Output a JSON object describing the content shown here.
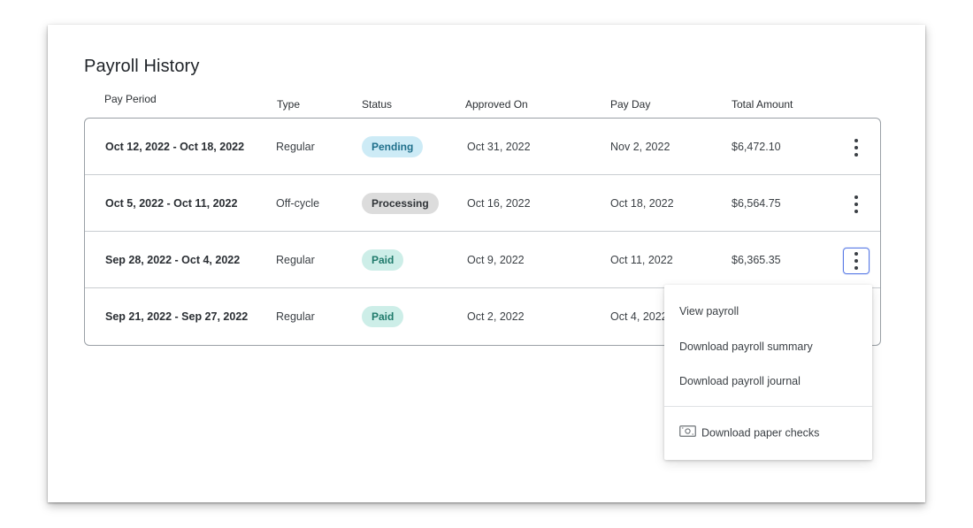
{
  "page": {
    "title": "Payroll History"
  },
  "columns": {
    "pay_period": "Pay Period",
    "type": "Type",
    "status": "Status",
    "approved_on": "Approved On",
    "pay_day": "Pay Day",
    "total_amount": "Total Amount"
  },
  "rows": [
    {
      "pay_period": "Oct 12, 2022 - Oct 18, 2022",
      "type": "Regular",
      "status": "Pending",
      "approved_on": "Oct 31, 2022",
      "pay_day": "Nov 2, 2022",
      "total_amount": "$6,472.10"
    },
    {
      "pay_period": "Oct 5, 2022 - Oct 11, 2022",
      "type": "Off-cycle",
      "status": "Processing",
      "approved_on": "Oct 16, 2022",
      "pay_day": "Oct 18, 2022",
      "total_amount": "$6,564.75"
    },
    {
      "pay_period": "Sep 28, 2022 - Oct 4, 2022",
      "type": "Regular",
      "status": "Paid",
      "approved_on": "Oct 9, 2022",
      "pay_day": "Oct 11, 2022",
      "total_amount": "$6,365.35"
    },
    {
      "pay_period": "Sep 21, 2022 - Sep 27, 2022",
      "type": "Regular",
      "status": "Paid",
      "approved_on": "Oct 2, 2022",
      "pay_day": "Oct 4, 2022",
      "total_amount": ""
    }
  ],
  "menu": {
    "items": [
      "View payroll",
      "Download payroll summary",
      "Download payroll journal"
    ],
    "paper_checks": "Download paper checks",
    "paper_checks_icon": "paper-check-icon"
  },
  "colors": {
    "pending_bg": "#cdebf6",
    "processing_bg": "#dcdcdc",
    "paid_bg": "#cdeee8",
    "focus_ring": "#5a7be6"
  }
}
